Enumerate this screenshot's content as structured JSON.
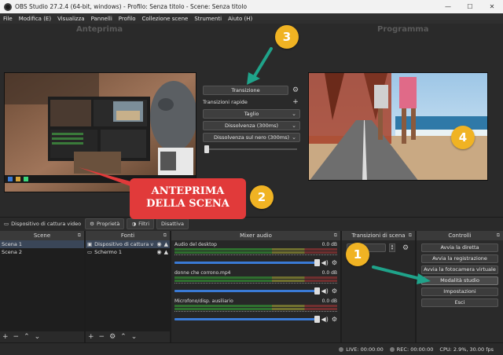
{
  "window": {
    "title": "OBS Studio 27.2.4 (64-bit, windows) - Profilo: Senza titolo - Scene: Senza titolo",
    "buttons": [
      "—",
      "☐",
      "✕"
    ]
  },
  "menu": [
    "File",
    "Modifica (E)",
    "Visualizza",
    "Pannelli",
    "Profilo",
    "Collezione scene",
    "Strumenti",
    "Aiuto (H)"
  ],
  "stage": {
    "preview_label": "Anteprima",
    "program_label": "Programma"
  },
  "transition_panel": {
    "transition_button": "Transizione",
    "quick_label": "Transizioni rapide",
    "items": [
      "Taglio",
      "Dissolvenza (300ms)",
      "Dissolvenza sul nero (300ms)"
    ]
  },
  "source_bar": {
    "source_name": "Dispositivo di cattura video",
    "properties": "Proprietà",
    "filters": "Filtri",
    "deactivate": "Disattiva"
  },
  "scenes": {
    "header": "Scene",
    "items": [
      "Scena 1",
      "Scena 2"
    ]
  },
  "sources": {
    "header": "Fonti",
    "items": [
      "Dispositivo di cattura v",
      "Schermo 1"
    ]
  },
  "mixer": {
    "header": "Mixer audio",
    "channels": [
      {
        "name": "Audio del desktop",
        "db": "0.0 dB"
      },
      {
        "name": "donne che corrono.mp4",
        "db": "0.0 dB"
      },
      {
        "name": "Microfono/disp. ausiliario",
        "db": "0.0 dB"
      }
    ]
  },
  "transitions_dock": {
    "header": "Transizioni di scena"
  },
  "controls": {
    "header": "Controlli",
    "buttons": [
      "Avvia la diretta",
      "Avvia la registrazione",
      "Avvia la fotocamera virtuale",
      "Modalità studio",
      "Impostazioni",
      "Esci"
    ]
  },
  "status": {
    "live": "LIVE: 00:00:00",
    "rec": "REC: 00:00:00",
    "cpu": "CPU: 2.9%, 30.00 fps"
  },
  "annotations": {
    "callout_line1": "ANTEPRIMA",
    "callout_line2": "DELLA SCENA",
    "badges": [
      "1",
      "2",
      "3",
      "4"
    ]
  },
  "colors": {
    "badge": "#f0b323",
    "callout": "#e13a3a",
    "arrow": "#1fa38a",
    "volume": "#3a7ad5"
  }
}
